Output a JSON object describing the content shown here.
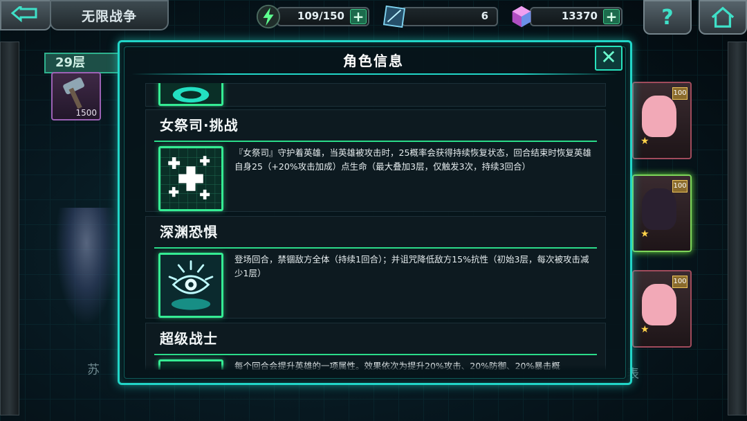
{
  "topbar": {
    "mode_label": "无限战争",
    "energy": "109/150",
    "crystals": "6",
    "gems": "13370",
    "plus_label": "+",
    "help_label": "?"
  },
  "background": {
    "floor": "29层",
    "item_count": "1500",
    "hero_level": "100",
    "left_text": "苏",
    "right_text": "表"
  },
  "modal": {
    "title": "角色信息",
    "close_label": "✕",
    "skills": [
      {
        "name": "女祭司·挑战",
        "description": "『女祭司』守护着英雄，当英雄被攻击时，25概率会获得持续恢复状态，回合结束时恢复英雄自身25（+20%攻击加成）点生命（最大叠加3层，仅触发3次，持续3回合）",
        "icon": "healing-crosses-icon"
      },
      {
        "name": "深渊恐惧",
        "description": "登场回合，禁锢敌方全体（持续1回合）；并诅咒降低敌方15%抗性（初始3层，每次被攻击减少1层）",
        "icon": "abyss-eye-icon"
      },
      {
        "name": "超级战士",
        "description": "每个回合会提升英雄的一项属性。效果依次为提升20%攻击、20%防御、20%暴击概",
        "icon": "super-warrior-icon"
      }
    ]
  },
  "colors": {
    "accent": "#22d6c8",
    "skill_border": "#35ec93",
    "plus": "#1c6b4c"
  }
}
